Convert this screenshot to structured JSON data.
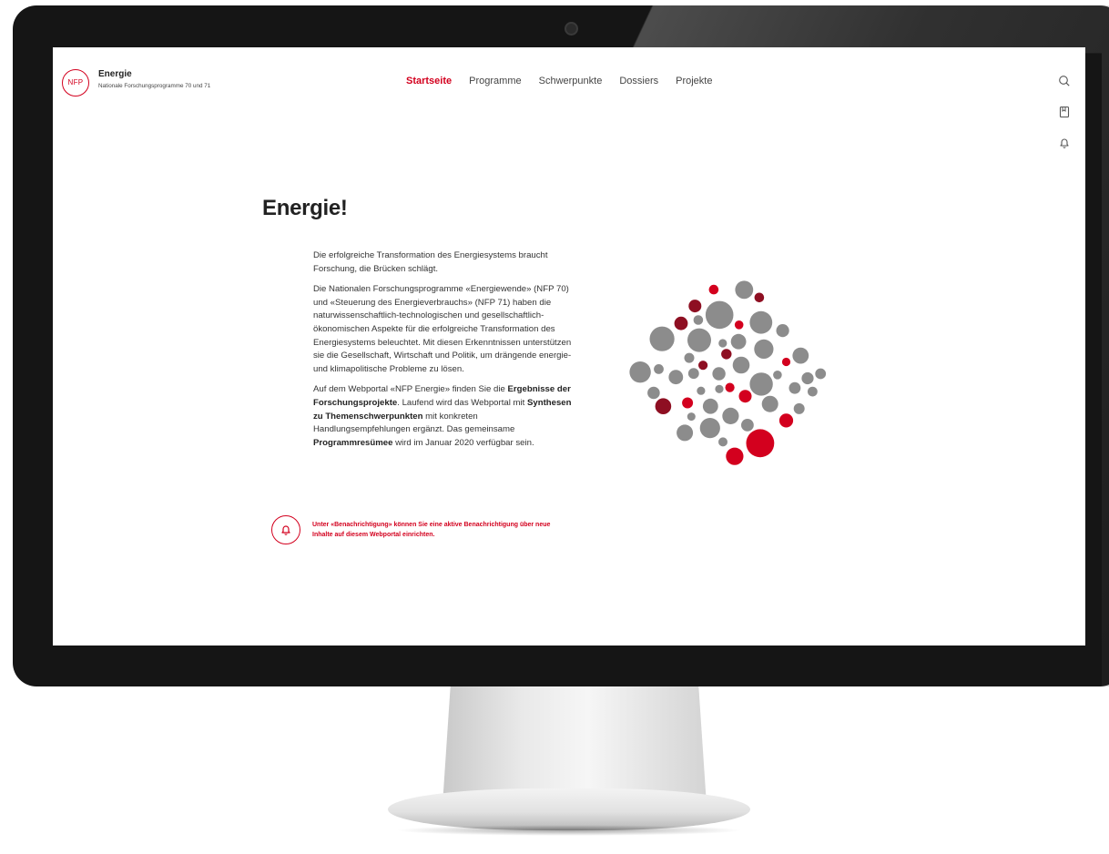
{
  "site": {
    "logo_text": "NFP",
    "title": "Energie",
    "subtitle": "Nationale Forschungsprogramme 70 und 71"
  },
  "nav": [
    {
      "label": "Startseite",
      "active": true
    },
    {
      "label": "Programme",
      "active": false
    },
    {
      "label": "Schwerpunkte",
      "active": false
    },
    {
      "label": "Dossiers",
      "active": false
    },
    {
      "label": "Projekte",
      "active": false
    }
  ],
  "side_icons": [
    "search-icon",
    "bookmark-icon",
    "bell-icon"
  ],
  "main": {
    "headline": "Energie!",
    "p1": "Die erfolgreiche Transformation des Energiesystems braucht Forschung, die Brücken schlägt.",
    "p2": "Die Nationalen Forschungsprogramme «Energiewende» (NFP 70) und «Steuerung des Energieverbrauchs» (NFP 71) haben die naturwissenschaftlich-technologischen und gesellschaftlich-ökonomischen Aspekte für die erfolgreiche Transformation des Energiesystems beleuchtet. Mit diesen Erkenntnissen unterstützen sie die Gesellschaft, Wirtschaft und Politik, um drängende energie- und klimapolitische Probleme zu lösen.",
    "p3_a": "Auf dem Webportal «NFP Energie» finden Sie die ",
    "p3_b": "Ergebnisse der Forschungsprojekte",
    "p3_c": ". Laufend wird das Webportal mit ",
    "p3_d": "Synthesen zu Themenschwerpunkten",
    "p3_e": " mit konkreten Handlungsempfehlungen ergänzt. Das gemeinsame ",
    "p3_f": "Programmresümee",
    "p3_g": " wird im Januar 2020 verfügbar sein.",
    "notice": "Unter «Benachrichtigung» können Sie eine aktive Benachrichtigung über neue Inhalte auf diesem Webportal einrichten."
  },
  "colors": {
    "brand_red": "#d3001e",
    "dark_red": "#8e0f22",
    "grey": "#8c8c8c"
  }
}
